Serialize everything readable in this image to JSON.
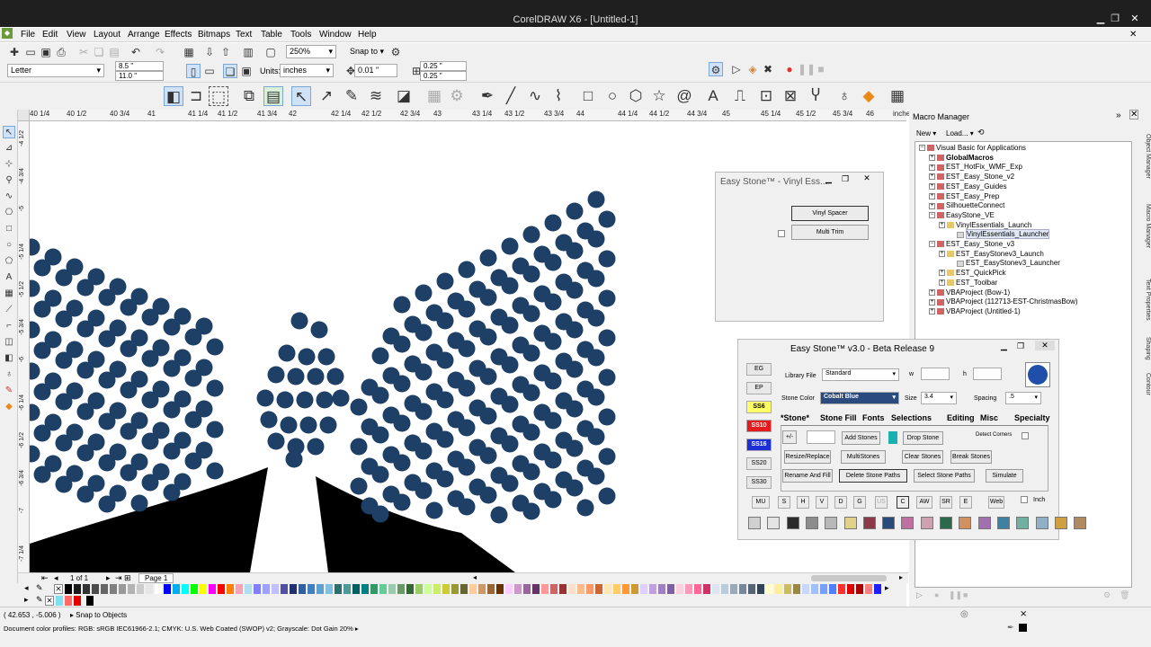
{
  "window": {
    "title": "CorelDRAW X6 - [Untitled-1]"
  },
  "menu": [
    "File",
    "Edit",
    "View",
    "Layout",
    "Arrange",
    "Effects",
    "Bitmaps",
    "Text",
    "Table",
    "Tools",
    "Window",
    "Help"
  ],
  "standard_toolbar": {
    "zoom": "250%",
    "snap_to": "Snap to"
  },
  "property_bar": {
    "page_size": "Letter",
    "width": "8.5 \"",
    "height": "11.0 \"",
    "units_label": "Units:",
    "units": "inches",
    "nudge": "0.01 \"",
    "dup_x": "0.25 \"",
    "dup_y": "0.25 \""
  },
  "ruler": {
    "h_ticks": [
      "40 1/4",
      "40 1/2",
      "40 3/4",
      "41",
      "41 1/4",
      "41 1/2",
      "41 3/4",
      "42",
      "42 1/4",
      "42 1/2",
      "42 3/4",
      "43",
      "43 1/4",
      "43 1/2",
      "43 3/4",
      "44",
      "44 1/4",
      "44 1/2",
      "44 3/4",
      "45",
      "45 1/4",
      "45 1/2",
      "45 3/4",
      "46",
      "inches"
    ],
    "v_ticks": [
      "-4 1/2",
      "-4 3/4",
      "-5",
      "-5 1/4",
      "-5 1/2",
      "-5 3/4",
      "-6",
      "-6 1/4",
      "-6 1/2",
      "-6 3/4",
      "-7",
      "-7 1/4"
    ]
  },
  "page_nav": {
    "page_count": "1 of 1",
    "page_tab": "Page 1"
  },
  "status": {
    "coords": "( 42.653 , -5.006 )",
    "snap": "Snap to Objects",
    "color_profile": "Document color profiles: RGB: sRGB IEC61966-2.1; CMYK: U.S. Web Coated (SWOP) v2; Grayscale: Dot Gain 20%"
  },
  "macro_manager": {
    "title": "Macro Manager",
    "new_label": "New",
    "load_label": "Load...",
    "tree": [
      {
        "label": "Visual Basic for Applications",
        "indent": 0,
        "kind": "root",
        "bold": false
      },
      {
        "label": "GlobalMacros",
        "indent": 1,
        "kind": "proj",
        "bold": true
      },
      {
        "label": "EST_HotFix_WMF_Exp",
        "indent": 1,
        "kind": "proj",
        "bold": false
      },
      {
        "label": "EST_Easy_Stone_v2",
        "indent": 1,
        "kind": "proj",
        "bold": false
      },
      {
        "label": "EST_Easy_Guides",
        "indent": 1,
        "kind": "proj",
        "bold": false
      },
      {
        "label": "EST_Easy_Prep",
        "indent": 1,
        "kind": "proj",
        "bold": false
      },
      {
        "label": "SilhouetteConnect",
        "indent": 1,
        "kind": "proj",
        "bold": false
      },
      {
        "label": "EasyStone_VE",
        "indent": 1,
        "kind": "proj",
        "bold": false
      },
      {
        "label": "VinylEssentials_Launch",
        "indent": 2,
        "kind": "fold",
        "bold": false
      },
      {
        "label": "VinylEssentials_Launcher",
        "indent": 3,
        "kind": "doc",
        "bold": false
      },
      {
        "label": "EST_Easy_Stone_v3",
        "indent": 1,
        "kind": "proj",
        "bold": false
      },
      {
        "label": "EST_EasyStonev3_Launch",
        "indent": 2,
        "kind": "fold",
        "bold": false
      },
      {
        "label": "EST_EasyStonev3_Launcher",
        "indent": 3,
        "kind": "doc",
        "bold": false
      },
      {
        "label": "EST_QuickPick",
        "indent": 2,
        "kind": "fold",
        "bold": false
      },
      {
        "label": "EST_Toolbar",
        "indent": 2,
        "kind": "fold",
        "bold": false
      },
      {
        "label": "VBAProject (Bow-1)",
        "indent": 1,
        "kind": "proj",
        "bold": false
      },
      {
        "label": "VBAProject (112713-EST-ChristmasBow)",
        "indent": 1,
        "kind": "proj",
        "bold": false
      },
      {
        "label": "VBAProject (Untitled-1)",
        "indent": 1,
        "kind": "proj",
        "bold": false
      }
    ]
  },
  "dock_tabs": [
    "Object Manager",
    "Macro Manager",
    "Text Properties",
    "Shaping",
    "Contour"
  ],
  "vinyl_window": {
    "title": "Easy Stone™ - Vinyl Ess...",
    "btn_spacer": "Vinyl Spacer",
    "btn_multitrim": "Multi Trim"
  },
  "easy_stone": {
    "title": "Easy Stone™ v3.0 - Beta Release 9",
    "side_buttons": [
      {
        "label": "EG",
        "bg": "#e8e8e8",
        "fg": "#000"
      },
      {
        "label": "EP",
        "bg": "#e8e8e8",
        "fg": "#000"
      },
      {
        "label": "SS6",
        "bg": "#ffff66",
        "fg": "#000"
      },
      {
        "label": "SS10",
        "bg": "#e21c1c",
        "fg": "#fff"
      },
      {
        "label": "SS16",
        "bg": "#1c2fd6",
        "fg": "#fff"
      },
      {
        "label": "SS20",
        "bg": "#e8e8e8",
        "fg": "#000"
      },
      {
        "label": "SS30",
        "bg": "#e8e8e8",
        "fg": "#000"
      }
    ],
    "library_label": "Library File",
    "library_value": "Standard",
    "w_label": "w",
    "h_label": "h",
    "stone_color_label": "Stone Color",
    "stone_color_value": "Cobalt Blue",
    "size_label": "Size",
    "size_value": "3.4",
    "spacing_label": "Spacing",
    "spacing_value": ".5",
    "tabs": [
      "*Stone*",
      "Stone Fill",
      "Fonts",
      "Selections",
      "Editing",
      "Misc",
      "Specialty"
    ],
    "plus_minus": "+/-",
    "btn_add": "Add Stones",
    "btn_drop": "Drop Stone",
    "detect_corners": "Detect Corners",
    "btn_resize": "Resize/Replace",
    "btn_multi": "MultiStones",
    "btn_clear": "Clear Stones",
    "btn_break": "Break Stones",
    "btn_rename": "Rename And Fill",
    "btn_delete_paths": "Delete Stone Paths",
    "btn_select_paths": "Select Stone Paths",
    "btn_simulate": "Simulate",
    "small_buttons": [
      "MU",
      "S",
      "H",
      "V",
      "D",
      "G",
      "US",
      "C",
      "AW",
      "SR",
      "E",
      "Web"
    ],
    "inch_label": "Inch",
    "color_swatches": [
      "#d0d0d0",
      "#e4e4e4",
      "#2a2a2a",
      "#8c8c8c",
      "#b8b8b8",
      "#e0d28a",
      "#8c3a4a",
      "#2a4a7a",
      "#c070a0",
      "#d0a0b0",
      "#2a6a4a",
      "#d09060",
      "#a070b0",
      "#4080a0",
      "#70b0a0",
      "#90b0c8",
      "#d0a040",
      "#b08a60"
    ],
    "stone_preview_color": "#1f4fa8"
  },
  "canvas": {
    "stone_color": "#1e3f66",
    "fill_color": "#000000"
  }
}
